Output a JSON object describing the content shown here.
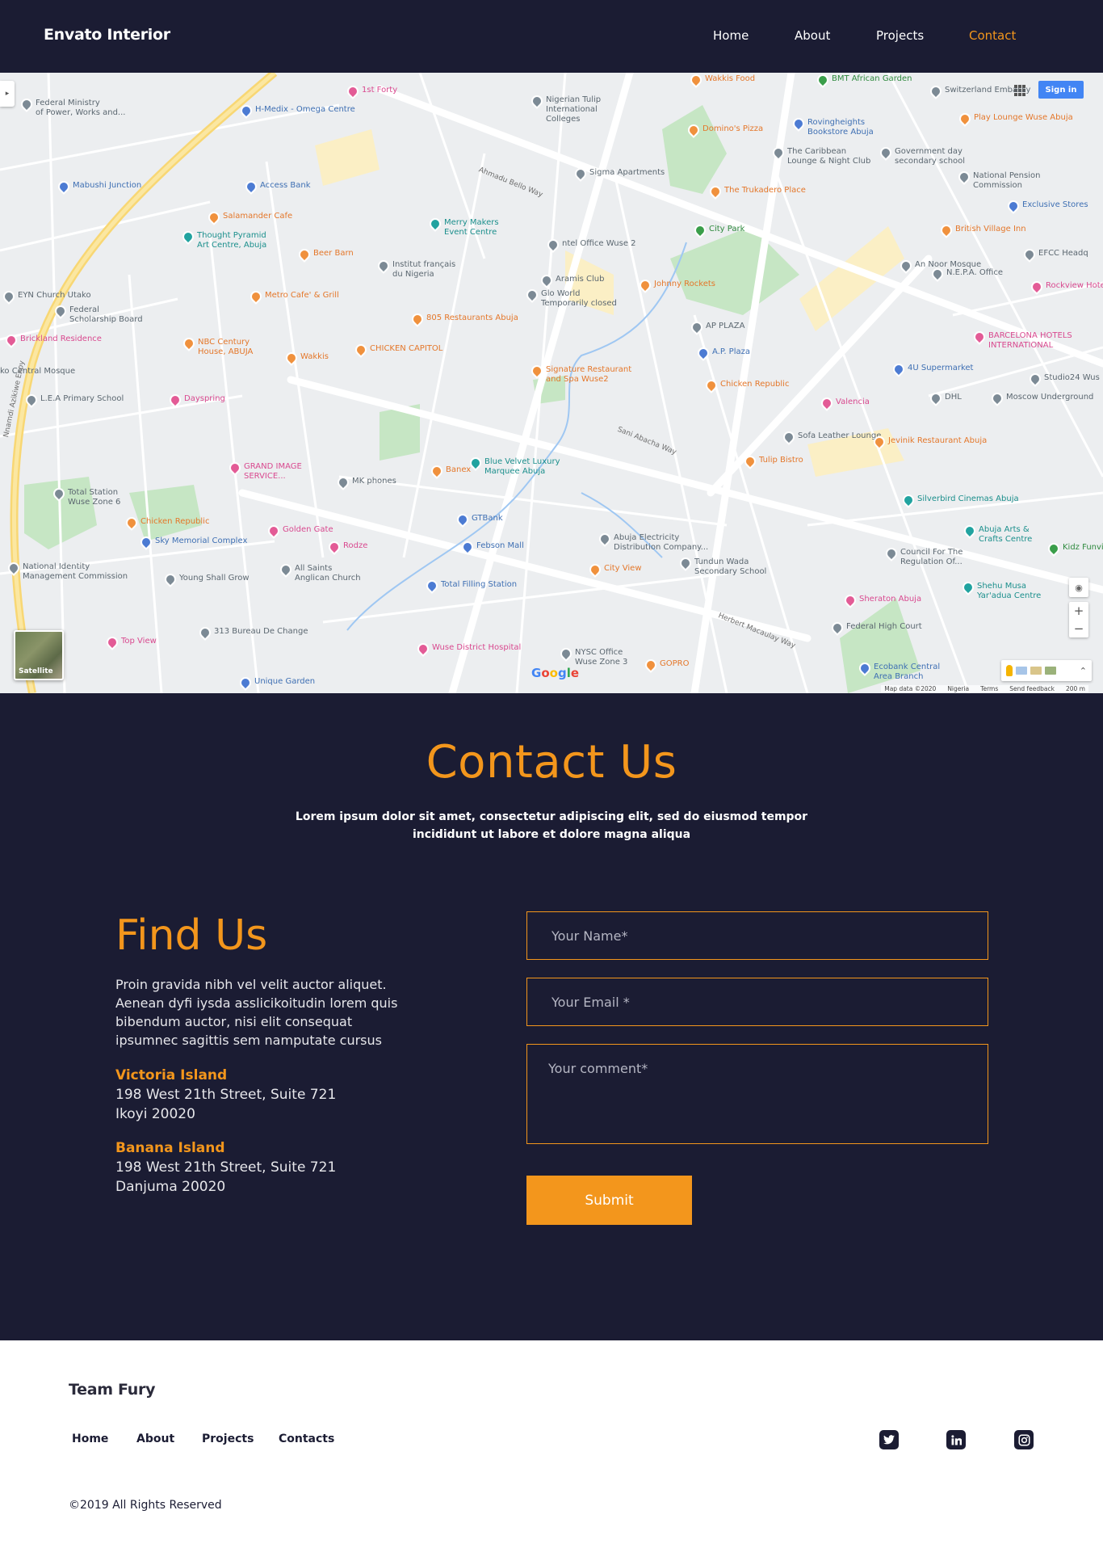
{
  "nav": {
    "brand": "Envato Interior",
    "links": [
      "Home",
      "About",
      "Projects",
      "Contact"
    ],
    "active": "Contact"
  },
  "map": {
    "sign_in": "Sign in",
    "satellite_label": "Satellite",
    "google": "Google",
    "attribution": [
      "Map data ©2020",
      "Nigeria",
      "Terms",
      "Send feedback",
      "200 m"
    ],
    "places": [
      {
        "name": "Federal Ministry\nof Power, Works and...",
        "kind": "grey"
      },
      {
        "name": "H-Medix - Omega Centre",
        "kind": "blue"
      },
      {
        "name": "1st Forty",
        "kind": "pink"
      },
      {
        "name": "Nigerian Tulip\nInternational\nColleges",
        "kind": "grey"
      },
      {
        "name": "Wakkis Food",
        "kind": "orange"
      },
      {
        "name": "BMT African Garden",
        "kind": "green"
      },
      {
        "name": "Switzerland Embassy",
        "kind": "grey"
      },
      {
        "name": "Play Lounge Wuse Abuja",
        "kind": "orange"
      },
      {
        "name": "Domino's Pizza",
        "kind": "orange"
      },
      {
        "name": "Rovingheights\nBookstore Abuja",
        "kind": "blue"
      },
      {
        "name": "The Caribbean\nLounge & Night Club",
        "kind": "grey"
      },
      {
        "name": "Government day\nsecondary school",
        "kind": "grey"
      },
      {
        "name": "Mabushi Junction",
        "kind": "blue"
      },
      {
        "name": "Access Bank",
        "kind": "blue"
      },
      {
        "name": "Sigma Apartments",
        "kind": "grey"
      },
      {
        "name": "National Pension\nCommission",
        "kind": "grey"
      },
      {
        "name": "The Trukadero Place",
        "kind": "orange"
      },
      {
        "name": "Exclusive Stores",
        "kind": "blue"
      },
      {
        "name": "Salamander Cafe",
        "kind": "orange"
      },
      {
        "name": "Merry Makers\nEvent Centre",
        "kind": "teal"
      },
      {
        "name": "City Park",
        "kind": "green"
      },
      {
        "name": "British Village Inn",
        "kind": "orange"
      },
      {
        "name": "Thought Pyramid\nArt Centre, Abuja",
        "kind": "teal"
      },
      {
        "name": "ntel Office Wuse 2",
        "kind": "grey"
      },
      {
        "name": "Beer Barn",
        "kind": "orange"
      },
      {
        "name": "Institut français\ndu Nigeria",
        "kind": "grey"
      },
      {
        "name": "An Noor Mosque",
        "kind": "grey"
      },
      {
        "name": "EFCC Headq",
        "kind": "grey"
      },
      {
        "name": "N.E.P.A. Office",
        "kind": "grey"
      },
      {
        "name": "Aramis Club",
        "kind": "grey"
      },
      {
        "name": "Johnny Rockets",
        "kind": "orange"
      },
      {
        "name": "Rockview Hotel R",
        "kind": "pink"
      },
      {
        "name": "EYN Church Utako",
        "kind": "grey"
      },
      {
        "name": "Metro Cafe' & Grill",
        "kind": "orange"
      },
      {
        "name": "Glo World\nTemporarily closed",
        "kind": "grey"
      },
      {
        "name": "Federal\nScholarship Board",
        "kind": "grey"
      },
      {
        "name": "805 Restaurants Abuja",
        "kind": "orange"
      },
      {
        "name": "AP PLAZA",
        "kind": "grey"
      },
      {
        "name": "Brickland Residence",
        "kind": "pink"
      },
      {
        "name": "NBC Century\nHouse, ABUJA",
        "kind": "orange"
      },
      {
        "name": "CHICKEN CAPITOL",
        "kind": "orange"
      },
      {
        "name": "A.P. Plaza",
        "kind": "blue"
      },
      {
        "name": "BARCELONA HOTELS\nINTERNATIONAL",
        "kind": "pink"
      },
      {
        "name": "Wakkis",
        "kind": "orange"
      },
      {
        "name": "ko Central Mosque",
        "kind": "grey"
      },
      {
        "name": "Signature Restaurant\nand Spa Wuse2",
        "kind": "orange"
      },
      {
        "name": "4U Supermarket",
        "kind": "blue"
      },
      {
        "name": "Studio24 Wus",
        "kind": "grey"
      },
      {
        "name": "L.E.A Primary School",
        "kind": "grey"
      },
      {
        "name": "Dayspring",
        "kind": "pink"
      },
      {
        "name": "Chicken Republic",
        "kind": "orange"
      },
      {
        "name": "DHL",
        "kind": "grey"
      },
      {
        "name": "Valencia",
        "kind": "pink"
      },
      {
        "name": "Moscow Underground",
        "kind": "grey"
      },
      {
        "name": "Sofa Leather Lounge",
        "kind": "grey"
      },
      {
        "name": "Jevinik Restaurant Abuja",
        "kind": "orange"
      },
      {
        "name": "GRAND IMAGE\nSERVICE...",
        "kind": "pink"
      },
      {
        "name": "Banex",
        "kind": "orange"
      },
      {
        "name": "Blue Velvet Luxury\nMarquee Abuja",
        "kind": "teal"
      },
      {
        "name": "Tulip Bistro",
        "kind": "orange"
      },
      {
        "name": "MK phones",
        "kind": "grey"
      },
      {
        "name": "Total Station\nWuse Zone 6",
        "kind": "grey"
      },
      {
        "name": "Silverbird Cinemas Abuja",
        "kind": "teal"
      },
      {
        "name": "Chicken Republic",
        "kind": "orange"
      },
      {
        "name": "Golden Gate",
        "kind": "pink"
      },
      {
        "name": "GTBank",
        "kind": "blue"
      },
      {
        "name": "Abuja Arts &\nCrafts Centre",
        "kind": "teal"
      },
      {
        "name": "Sky Memorial Complex",
        "kind": "blue"
      },
      {
        "name": "Rodze",
        "kind": "pink"
      },
      {
        "name": "Febson Mall",
        "kind": "blue"
      },
      {
        "name": "Abuja Electricity\nDistribution Company...",
        "kind": "grey"
      },
      {
        "name": "Tundun Wada\nSecondary School",
        "kind": "grey"
      },
      {
        "name": "Council For The\nRegulation Of...",
        "kind": "grey"
      },
      {
        "name": "Kidz Funville",
        "kind": "green"
      },
      {
        "name": "National Identity\nManagement Commission",
        "kind": "grey"
      },
      {
        "name": "All Saints\nAnglican Church",
        "kind": "grey"
      },
      {
        "name": "Young Shall Grow",
        "kind": "grey"
      },
      {
        "name": "City View",
        "kind": "orange"
      },
      {
        "name": "Total Filling Station",
        "kind": "blue"
      },
      {
        "name": "Shehu Musa\nYar'adua Centre",
        "kind": "teal"
      },
      {
        "name": "Sheraton Abuja",
        "kind": "pink"
      },
      {
        "name": "Federal High Court",
        "kind": "grey"
      },
      {
        "name": "313 Bureau De Change",
        "kind": "grey"
      },
      {
        "name": "Top View",
        "kind": "pink"
      },
      {
        "name": "Wuse District Hospital",
        "kind": "pink"
      },
      {
        "name": "NYSC Office\nWuse Zone 3",
        "kind": "grey"
      },
      {
        "name": "GOPRO",
        "kind": "orange"
      },
      {
        "name": "Herbert Macaulay Way",
        "kind": "road"
      },
      {
        "name": "Ecobank Central\nArea Branch",
        "kind": "blue"
      },
      {
        "name": "Unique Garden",
        "kind": "blue"
      },
      {
        "name": "Nnamdi Azikiwe Expy",
        "kind": "road"
      },
      {
        "name": "Ahmadu Bello Way",
        "kind": "road"
      },
      {
        "name": "Sani Abacha Way",
        "kind": "road"
      }
    ]
  },
  "contact": {
    "title": "Contact Us",
    "subtitle": "Lorem ipsum dolor sit amet, consectetur adipiscing elit, sed do eiusmod tempor incididunt ut labore et dolore magna aliqua",
    "find_title": "Find Us",
    "find_text": "Proin gravida nibh vel velit auctor aliquet. Aenean dyfi iysda asslicikoitudin lorem quis bibendum auctor, nisi elit consequat ipsumnec sagittis sem namputate cursus",
    "offices": [
      {
        "name": "Victoria Island",
        "line1": "198 West 21th Street, Suite 721",
        "line2": "Ikoyi 20020"
      },
      {
        "name": "Banana Island",
        "line1": "198 West 21th Street, Suite 721",
        "line2": "Danjuma 20020"
      }
    ],
    "form": {
      "name_placeholder": "Your Name*",
      "email_placeholder": "Your Email *",
      "comment_placeholder": "Your comment*",
      "submit": "Submit"
    }
  },
  "footer": {
    "brand": "Team Fury",
    "links": [
      "Home",
      "About",
      "Projects",
      "Contacts"
    ],
    "social": [
      "twitter-icon",
      "linkedin-icon",
      "instagram-icon"
    ],
    "copyright": "©2019 All Rights Reserved"
  },
  "colors": {
    "navy": "#1b1c33",
    "accent": "#f3961c",
    "white": "#ffffff"
  }
}
